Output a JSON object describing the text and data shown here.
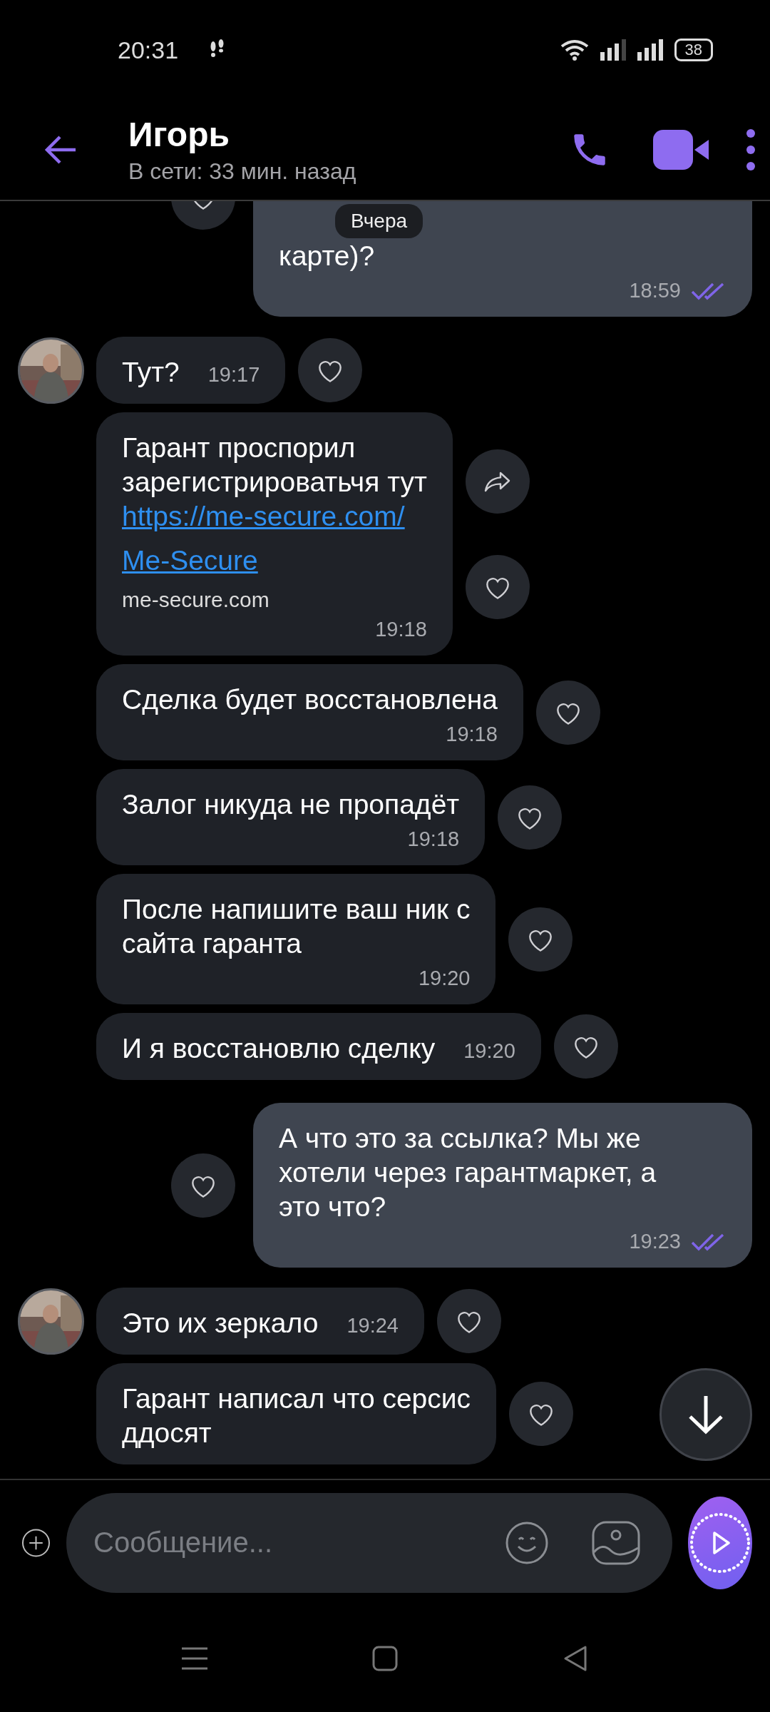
{
  "status_bar": {
    "time": "20:31",
    "battery": "38"
  },
  "header": {
    "name": "Игорь",
    "status": "В сети: 33 мин. назад"
  },
  "date_pill": "Вчера",
  "messages": [
    {
      "kind": "out",
      "text": "карте)?",
      "time": "18:59",
      "read": true
    },
    {
      "kind": "in",
      "avatar": true,
      "text": "Тут?",
      "time": "19:17",
      "time_inline": true
    },
    {
      "kind": "link",
      "avatar": false,
      "text": "Гарант проспорил\nзарегистрироватьчя тут",
      "url": "https://me-secure.com/",
      "preview_title": "Me-Secure",
      "preview_domain": "me-secure.com",
      "time": "19:18"
    },
    {
      "kind": "in",
      "avatar": false,
      "text": "Сделка будет восстановлена",
      "time": "19:18",
      "time_inline": false
    },
    {
      "kind": "in",
      "avatar": false,
      "text": "Залог никуда не пропадёт",
      "time": "19:18",
      "time_inline": false
    },
    {
      "kind": "in",
      "avatar": false,
      "text": "После напишите ваш ник с\nсайта гаранта",
      "time": "19:20",
      "time_inline": false
    },
    {
      "kind": "in",
      "avatar": false,
      "text": "И я восстановлю сделку",
      "time": "19:20",
      "time_inline": true
    },
    {
      "kind": "out",
      "text": "А что это за ссылка? Мы же\nхотели через гарантмаркет, а\nэто что?",
      "time": "19:23",
      "read": true
    },
    {
      "kind": "in",
      "avatar": true,
      "text": "Это их зеркало",
      "time": "19:24",
      "time_inline": true
    },
    {
      "kind": "in",
      "avatar": false,
      "text": "Гарант написал что серсис\nддосят",
      "time_inline": false
    }
  ],
  "composer": {
    "placeholder": "Сообщение..."
  }
}
